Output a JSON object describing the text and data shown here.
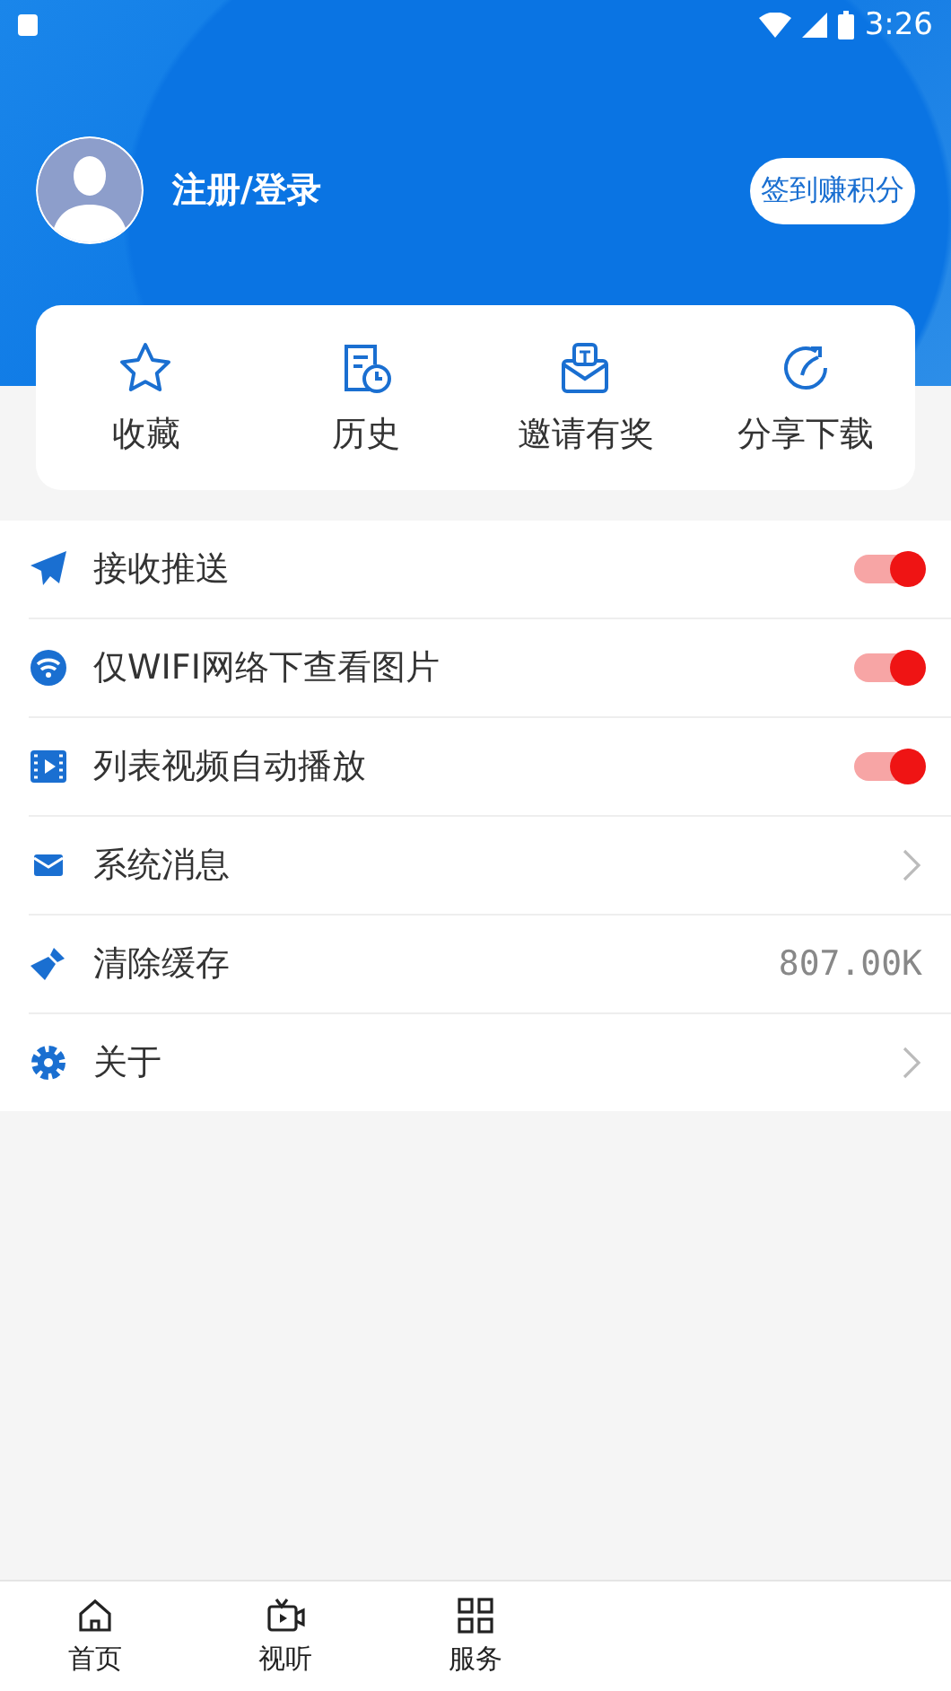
{
  "status_bar": {
    "time": "3:26"
  },
  "profile": {
    "login_label": "注册/登录",
    "checkin_button": "签到赚积分"
  },
  "shortcuts": [
    {
      "kind": "star",
      "label": "收藏"
    },
    {
      "kind": "history",
      "label": "历史"
    },
    {
      "kind": "invite",
      "label": "邀请有奖"
    },
    {
      "kind": "share",
      "label": "分享下载"
    }
  ],
  "settings": [
    {
      "label": "接收推送",
      "kind": "toggle",
      "on": true
    },
    {
      "label": "仅WIFI网络下查看图片",
      "kind": "toggle",
      "on": true
    },
    {
      "label": "列表视频自动播放",
      "kind": "toggle",
      "on": true
    },
    {
      "label": "系统消息",
      "kind": "link"
    },
    {
      "label": "清除缓存",
      "kind": "value",
      "value": "807.00K"
    },
    {
      "label": "关于",
      "kind": "link"
    }
  ],
  "bottom_nav": [
    {
      "label": "首页"
    },
    {
      "label": "视听"
    },
    {
      "label": "服务"
    }
  ]
}
